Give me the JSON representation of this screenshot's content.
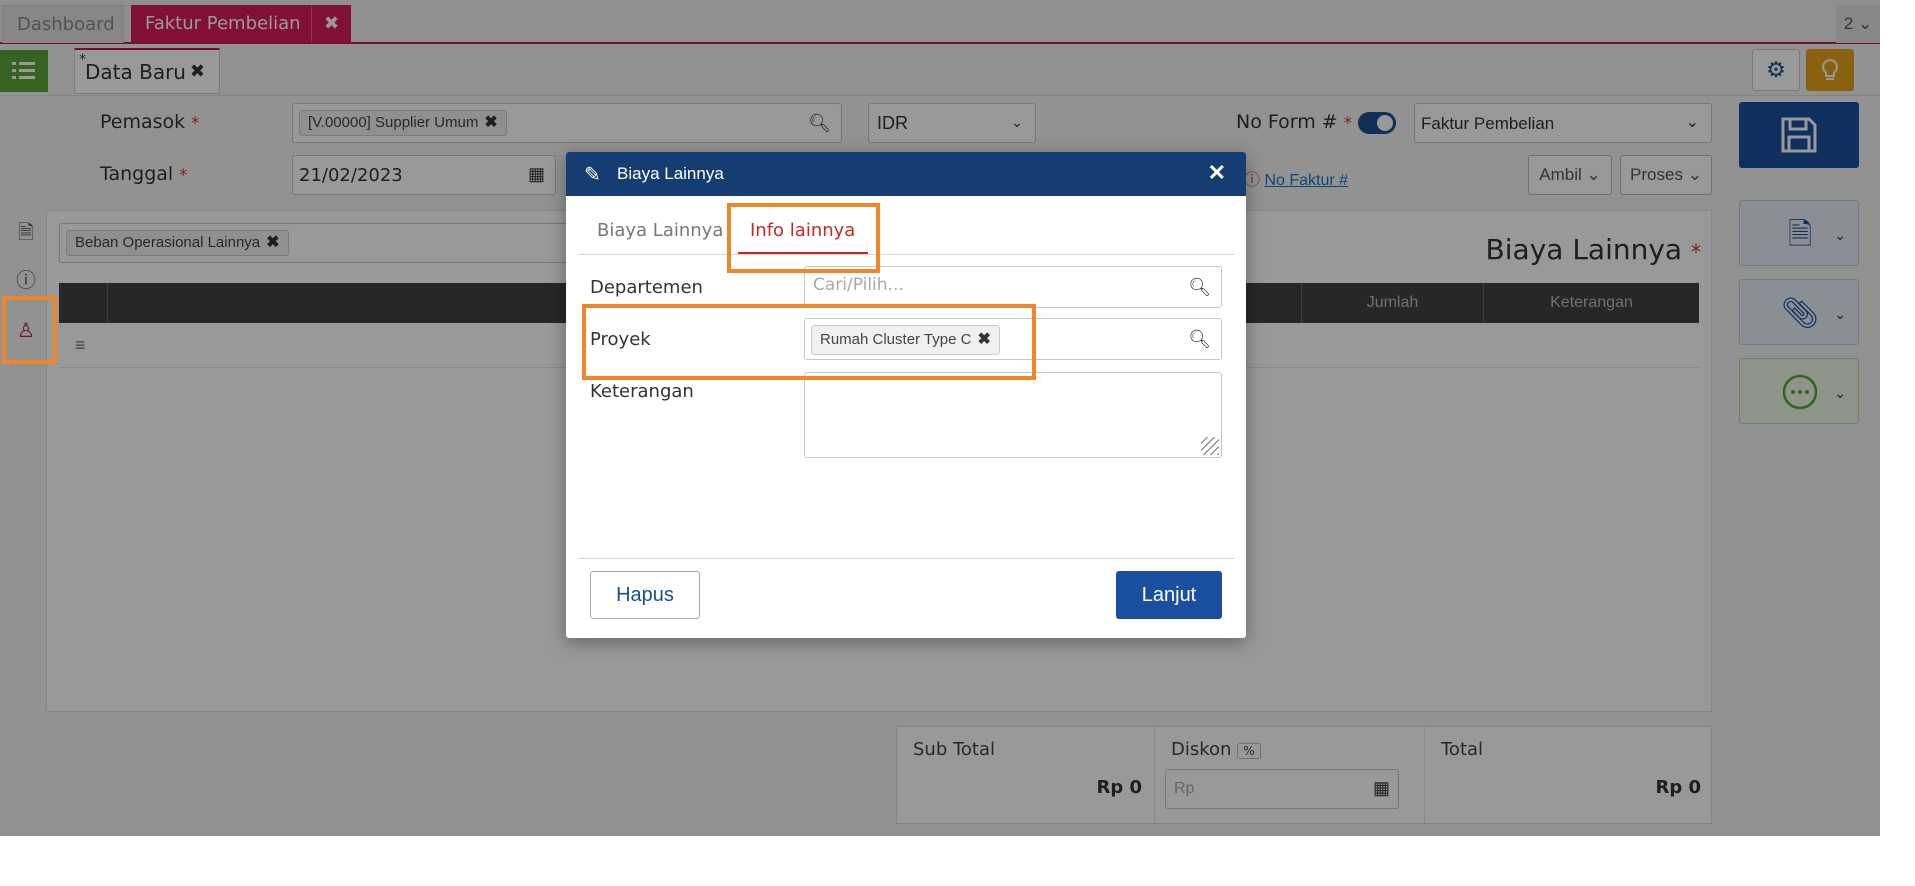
{
  "top_tabs": [
    {
      "label": "Dashboard"
    },
    {
      "label": "Faktur Pembelian",
      "close": "✖"
    }
  ],
  "top_counter": "2 ⌄",
  "doc_tab": {
    "star": "*",
    "label": "Data Baru",
    "close": "✖"
  },
  "form": {
    "pemasok_label": "Pemasok",
    "required_mark": "*",
    "pemasok_value": "[V.00000] Supplier Umum",
    "currency": "IDR",
    "no_form_label": "No Form #",
    "form_type": "Faktur Pembelian",
    "tanggal_label": "Tanggal",
    "tanggal_value": "21/02/2023",
    "no_faktur_link": "No Faktur #",
    "ambil_label": "Ambil",
    "proses_label": "Proses"
  },
  "panel": {
    "account_chip": "Beban Operasional Lainnya",
    "title": "Biaya Lainnya",
    "columns": [
      "Jumlah",
      "Keterangan"
    ],
    "row_handle": "≡"
  },
  "totals": {
    "subtotal_label": "Sub Total",
    "subtotal_value": "Rp 0",
    "diskon_label": "Diskon",
    "diskon_unit": "%",
    "diskon_placeholder": "Rp",
    "total_label": "Total",
    "total_value": "Rp 0"
  },
  "modal": {
    "title": "Biaya Lainnya",
    "close": "✕",
    "tabs": [
      {
        "label": "Biaya Lainnya",
        "active": false
      },
      {
        "label": "Info lainnya",
        "active": true
      }
    ],
    "departemen_label": "Departemen",
    "departemen_placeholder": "Cari/Pilih...",
    "proyek_label": "Proyek",
    "proyek_value": "Rumah Cluster Type C",
    "keterangan_label": "Keterangan",
    "hapus_label": "Hapus",
    "lanjut_label": "Lanjut"
  },
  "colors": {
    "brand_pink": "#d81b60",
    "header_navy": "#163d72",
    "primary_blue": "#1a4f9f",
    "highlight_orange": "#f0862a",
    "active_tab_red": "#c62828"
  }
}
